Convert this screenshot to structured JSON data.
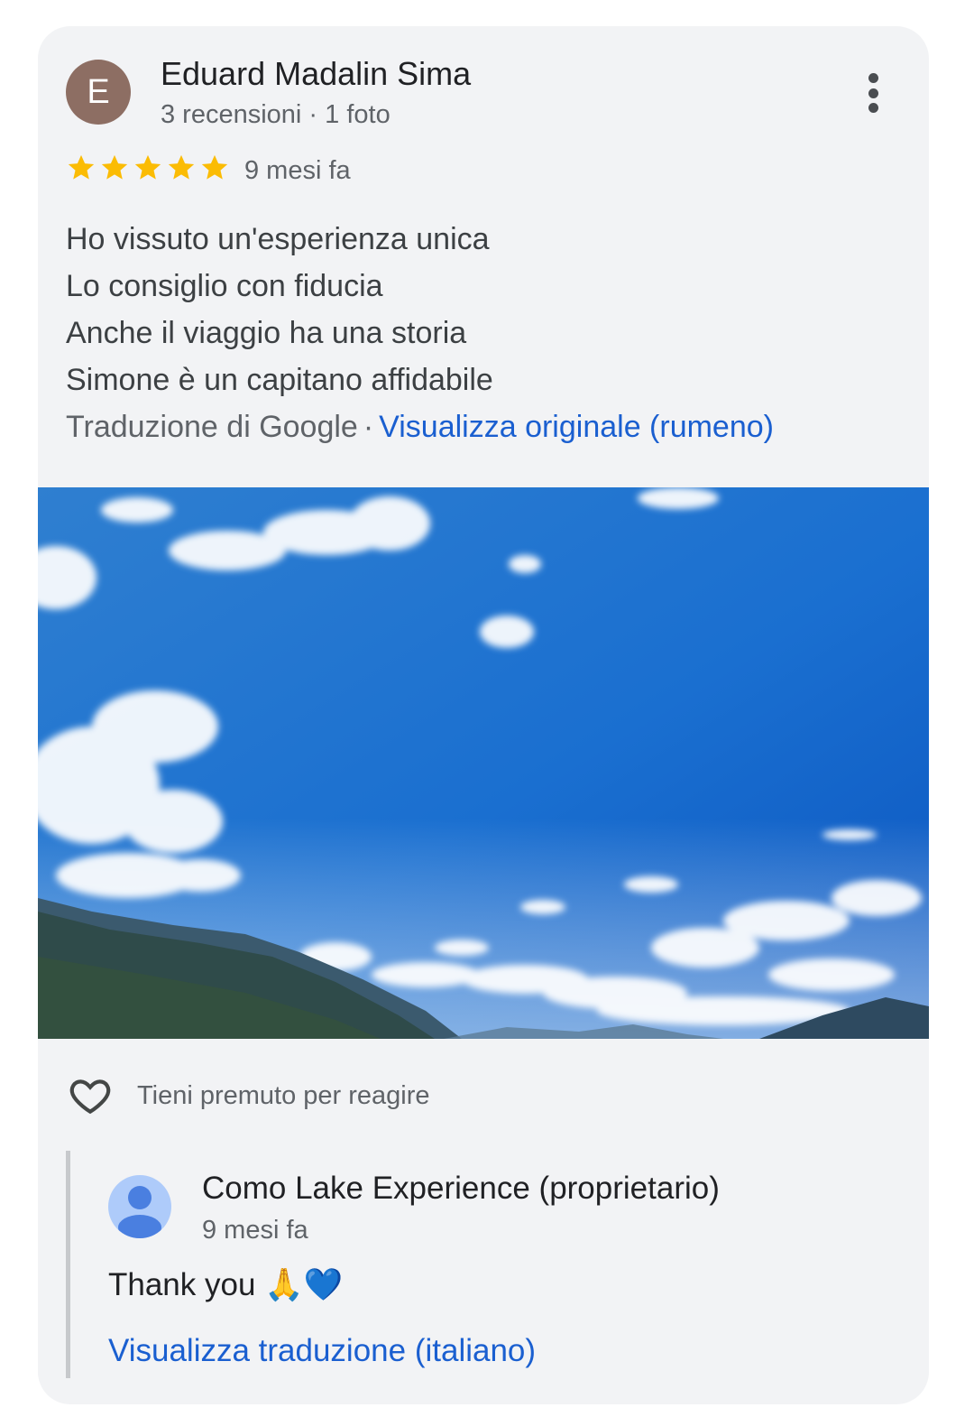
{
  "review": {
    "avatar_letter": "E",
    "avatar_color": "#8d6e63",
    "reviewer_name": "Eduard Madalin Sima",
    "reviewer_meta": "3 recensioni · 1 foto",
    "rating": 5,
    "rating_max": 5,
    "star_color": "#fbbc04",
    "time": "9 mesi fa",
    "text_lines": [
      "Ho vissuto un'esperienza unica",
      "Lo consiglio con fiducia",
      "Anche il viaggio ha una storia",
      "Simone è un capitano affidabile"
    ],
    "translation_source": "Traduzione di Google",
    "translation_sep": "·",
    "view_original_label": "Visualizza originale (rumeno)",
    "more_icon": "more-vert-icon"
  },
  "reactions": {
    "icon": "heart-outline-icon",
    "label": "Tieni premuto per reagire"
  },
  "owner_reply": {
    "avatar_icon": "person-icon",
    "name": "Como Lake Experience (proprietario)",
    "time": "9 mesi fa",
    "text": "Thank you 🙏💙",
    "translate_label": "Visualizza traduzione (italiano)"
  },
  "colors": {
    "link": "#1a5fd0",
    "card_bg": "#f2f3f5"
  }
}
